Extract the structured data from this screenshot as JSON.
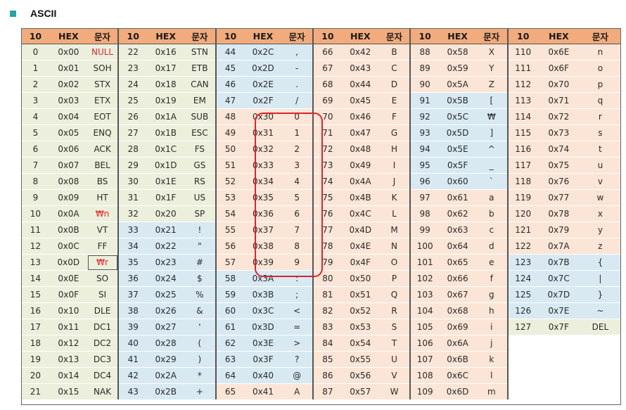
{
  "heading": {
    "title": "ASCII"
  },
  "columns": [
    "10",
    "HEX",
    "문자"
  ],
  "groups": [
    {
      "rows": [
        [
          "0",
          "0x00",
          "NULL"
        ],
        [
          "1",
          "0x01",
          "SOH"
        ],
        [
          "2",
          "0x02",
          "STX"
        ],
        [
          "3",
          "0x03",
          "ETX"
        ],
        [
          "4",
          "0x04",
          "EOT"
        ],
        [
          "5",
          "0x05",
          "ENQ"
        ],
        [
          "6",
          "0x06",
          "ACK"
        ],
        [
          "7",
          "0x07",
          "BEL"
        ],
        [
          "8",
          "0x08",
          "BS"
        ],
        [
          "9",
          "0x09",
          "HT"
        ],
        [
          "10",
          "0x0A",
          "₩n"
        ],
        [
          "11",
          "0x0B",
          "VT"
        ],
        [
          "12",
          "0x0C",
          "FF"
        ],
        [
          "13",
          "0x0D",
          "₩r"
        ],
        [
          "14",
          "0x0E",
          "SO"
        ],
        [
          "15",
          "0x0F",
          "SI"
        ],
        [
          "16",
          "0x10",
          "DLE"
        ],
        [
          "17",
          "0x11",
          "DC1"
        ],
        [
          "18",
          "0x12",
          "DC2"
        ],
        [
          "19",
          "0x13",
          "DC3"
        ],
        [
          "20",
          "0x14",
          "DC4"
        ],
        [
          "21",
          "0x15",
          "NAK"
        ]
      ]
    },
    {
      "rows": [
        [
          "22",
          "0x16",
          "STN"
        ],
        [
          "23",
          "0x17",
          "ETB"
        ],
        [
          "24",
          "0x18",
          "CAN"
        ],
        [
          "25",
          "0x19",
          "EM"
        ],
        [
          "26",
          "0x1A",
          "SUB"
        ],
        [
          "27",
          "0x1B",
          "ESC"
        ],
        [
          "28",
          "0x1C",
          "FS"
        ],
        [
          "29",
          "0x1D",
          "GS"
        ],
        [
          "30",
          "0x1E",
          "RS"
        ],
        [
          "31",
          "0x1F",
          "US"
        ],
        [
          "32",
          "0x20",
          "SP"
        ],
        [
          "33",
          "0x21",
          "!"
        ],
        [
          "34",
          "0x22",
          "\""
        ],
        [
          "35",
          "0x23",
          "#"
        ],
        [
          "36",
          "0x24",
          "$"
        ],
        [
          "37",
          "0x25",
          "%"
        ],
        [
          "38",
          "0x26",
          "&"
        ],
        [
          "39",
          "0x27",
          "'"
        ],
        [
          "40",
          "0x28",
          "("
        ],
        [
          "41",
          "0x29",
          ")"
        ],
        [
          "42",
          "0x2A",
          "*"
        ],
        [
          "43",
          "0x2B",
          "+"
        ]
      ]
    },
    {
      "rows": [
        [
          "44",
          "0x2C",
          ","
        ],
        [
          "45",
          "0x2D",
          "-"
        ],
        [
          "46",
          "0x2E",
          "."
        ],
        [
          "47",
          "0x2F",
          "/"
        ],
        [
          "48",
          "0x30",
          "0"
        ],
        [
          "49",
          "0x31",
          "1"
        ],
        [
          "50",
          "0x32",
          "2"
        ],
        [
          "51",
          "0x33",
          "3"
        ],
        [
          "52",
          "0x34",
          "4"
        ],
        [
          "53",
          "0x35",
          "5"
        ],
        [
          "54",
          "0x36",
          "6"
        ],
        [
          "55",
          "0x37",
          "7"
        ],
        [
          "56",
          "0x38",
          "8"
        ],
        [
          "57",
          "0x39",
          "9"
        ],
        [
          "58",
          "0x3A",
          ":"
        ],
        [
          "59",
          "0x3B",
          ";"
        ],
        [
          "60",
          "0x3C",
          "<"
        ],
        [
          "61",
          "0x3D",
          "="
        ],
        [
          "62",
          "0x3E",
          ">"
        ],
        [
          "63",
          "0x3F",
          "?"
        ],
        [
          "64",
          "0x40",
          "@"
        ],
        [
          "65",
          "0x41",
          "A"
        ]
      ]
    },
    {
      "rows": [
        [
          "66",
          "0x42",
          "B"
        ],
        [
          "67",
          "0x43",
          "C"
        ],
        [
          "68",
          "0x44",
          "D"
        ],
        [
          "69",
          "0x45",
          "E"
        ],
        [
          "70",
          "0x46",
          "F"
        ],
        [
          "71",
          "0x47",
          "G"
        ],
        [
          "72",
          "0x48",
          "H"
        ],
        [
          "73",
          "0x49",
          "I"
        ],
        [
          "74",
          "0x4A",
          "J"
        ],
        [
          "75",
          "0x4B",
          "K"
        ],
        [
          "76",
          "0x4C",
          "L"
        ],
        [
          "77",
          "0x4D",
          "M"
        ],
        [
          "78",
          "0x4E",
          "N"
        ],
        [
          "79",
          "0x4F",
          "O"
        ],
        [
          "80",
          "0x50",
          "P"
        ],
        [
          "81",
          "0x51",
          "Q"
        ],
        [
          "82",
          "0x52",
          "R"
        ],
        [
          "83",
          "0x53",
          "S"
        ],
        [
          "84",
          "0x54",
          "T"
        ],
        [
          "85",
          "0x55",
          "U"
        ],
        [
          "86",
          "0x56",
          "V"
        ],
        [
          "87",
          "0x57",
          "W"
        ]
      ]
    },
    {
      "rows": [
        [
          "88",
          "0x58",
          "X"
        ],
        [
          "89",
          "0x59",
          "Y"
        ],
        [
          "90",
          "0x5A",
          "Z"
        ],
        [
          "91",
          "0x5B",
          "["
        ],
        [
          "92",
          "0x5C",
          "₩"
        ],
        [
          "93",
          "0x5D",
          "]"
        ],
        [
          "94",
          "0x5E",
          "^"
        ],
        [
          "95",
          "0x5F",
          "_"
        ],
        [
          "96",
          "0x60",
          "`"
        ],
        [
          "97",
          "0x61",
          "a"
        ],
        [
          "98",
          "0x62",
          "b"
        ],
        [
          "99",
          "0x63",
          "c"
        ],
        [
          "100",
          "0x64",
          "d"
        ],
        [
          "101",
          "0x65",
          "e"
        ],
        [
          "102",
          "0x66",
          "f"
        ],
        [
          "103",
          "0x67",
          "g"
        ],
        [
          "104",
          "0x68",
          "h"
        ],
        [
          "105",
          "0x69",
          "i"
        ],
        [
          "106",
          "0x6A",
          "j"
        ],
        [
          "107",
          "0x6B",
          "k"
        ],
        [
          "108",
          "0x6C",
          "l"
        ],
        [
          "109",
          "0x6D",
          "m"
        ]
      ]
    },
    {
      "rows": [
        [
          "110",
          "0x6E",
          "n"
        ],
        [
          "111",
          "0x6F",
          "o"
        ],
        [
          "112",
          "0x70",
          "p"
        ],
        [
          "113",
          "0x71",
          "q"
        ],
        [
          "114",
          "0x72",
          "r"
        ],
        [
          "115",
          "0x73",
          "s"
        ],
        [
          "116",
          "0x74",
          "t"
        ],
        [
          "117",
          "0x75",
          "u"
        ],
        [
          "118",
          "0x76",
          "v"
        ],
        [
          "119",
          "0x77",
          "w"
        ],
        [
          "120",
          "0x78",
          "x"
        ],
        [
          "121",
          "0x79",
          "y"
        ],
        [
          "122",
          "0x7A",
          "z"
        ],
        [
          "123",
          "0x7B",
          "{"
        ],
        [
          "124",
          "0x7C",
          "|"
        ],
        [
          "125",
          "0x7D",
          "}"
        ],
        [
          "126",
          "0x7E",
          "~"
        ],
        [
          "127",
          "0x7F",
          "DEL"
        ]
      ]
    }
  ],
  "colors": {
    "header": "#f2ab7c",
    "control": "#ecefdc",
    "punctuation": "#d8e9f2",
    "alphanumeric": "#fbe5d6",
    "escape_text": "#e0262a",
    "highlight_border": "#d8262a",
    "bullet": "#27a3a3"
  },
  "highlight": {
    "label_hex_from": "0x30",
    "label_hex_to": "0x39"
  },
  "selected_cell": "0x0D",
  "red_text_cells": [
    "0x00",
    "0x0A",
    "0x0D"
  ]
}
